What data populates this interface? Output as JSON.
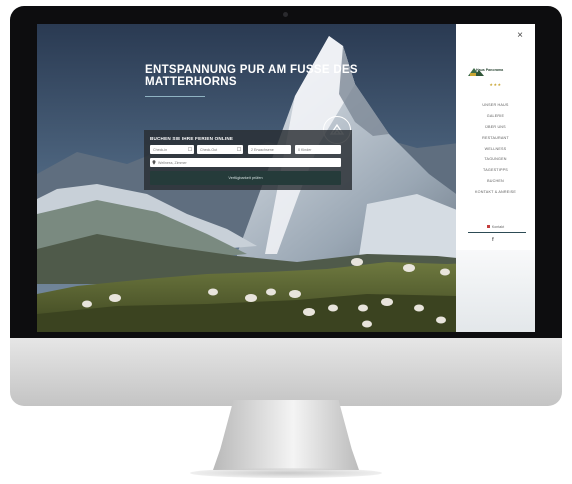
{
  "hero": {
    "headline": "ENTSPANNUNG PUR AM FUSSE DES MATTERHORNS"
  },
  "booking": {
    "title": "BUCHEN SIE IHRE FERIEN ONLINE",
    "checkin_placeholder": "Check-in",
    "checkout_placeholder": "Check-Out",
    "adults_value": "2 Erwachsene",
    "kids_value": "0 Kinder",
    "amenities_placeholder": "Wellness, Zimmer",
    "submit_label": "Verfügbarkeit prüfen"
  },
  "sidebar": {
    "close_symbol": "×",
    "brand_name": "Haus Panorama",
    "stars": "★★★",
    "menu": [
      "UNSER HAUS",
      "GALERIE",
      "ÜBER UNS",
      "RESTAURANT",
      "WELLNESS",
      "TAGUNGEN",
      "TAGESTIPPS",
      "BUCHEN",
      "KONTAKT & ANREISE"
    ],
    "contact_label": "Kontakt",
    "social_label": "f"
  },
  "colors": {
    "accent": "#2d4b55",
    "stars": "#c9a634",
    "form_bg": "#282d32",
    "button_bg": "#253b3a"
  },
  "icons": {
    "calendar": "calendar-icon",
    "location": "map-pin-icon",
    "close": "close-icon",
    "logo": "chalet-logo-icon",
    "facebook": "facebook-icon"
  }
}
